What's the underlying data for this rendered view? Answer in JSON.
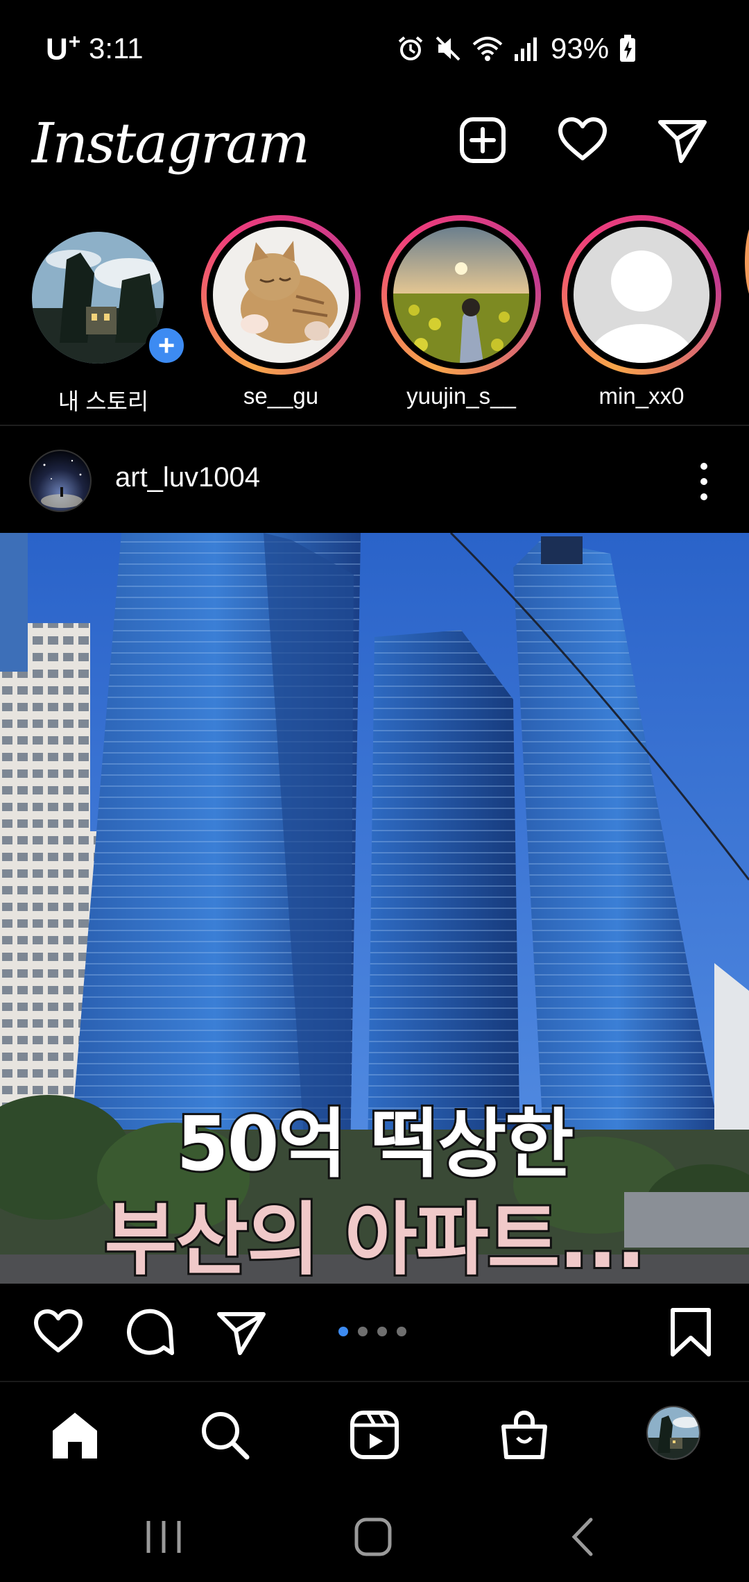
{
  "status_bar": {
    "carrier": "U",
    "carrier_sup": "+",
    "time": "3:11",
    "battery": "93%"
  },
  "header": {
    "logo": "Instagram"
  },
  "stories": [
    {
      "label": "내 스토리"
    },
    {
      "label": "se__gu"
    },
    {
      "label": "yuujin_s__"
    },
    {
      "label": "min_xx0"
    }
  ],
  "post": {
    "username": "art_luv1004",
    "caption_line1": "50억 떡상한",
    "caption_line2": "부산의 아파트...",
    "carousel": {
      "count": 4,
      "current": 1
    }
  },
  "colors": {
    "accent_blue": "#3d8bf2",
    "story_ring": "#ee3c7b",
    "caption_pink": "#f0c9c9"
  },
  "icons": {
    "header": [
      "plus-square-icon",
      "heart-icon",
      "send-icon"
    ],
    "actions": [
      "heart-icon",
      "comment-icon",
      "send-icon",
      "bookmark-icon"
    ],
    "nav": [
      "home-icon",
      "search-icon",
      "reels-icon",
      "shop-icon"
    ]
  }
}
